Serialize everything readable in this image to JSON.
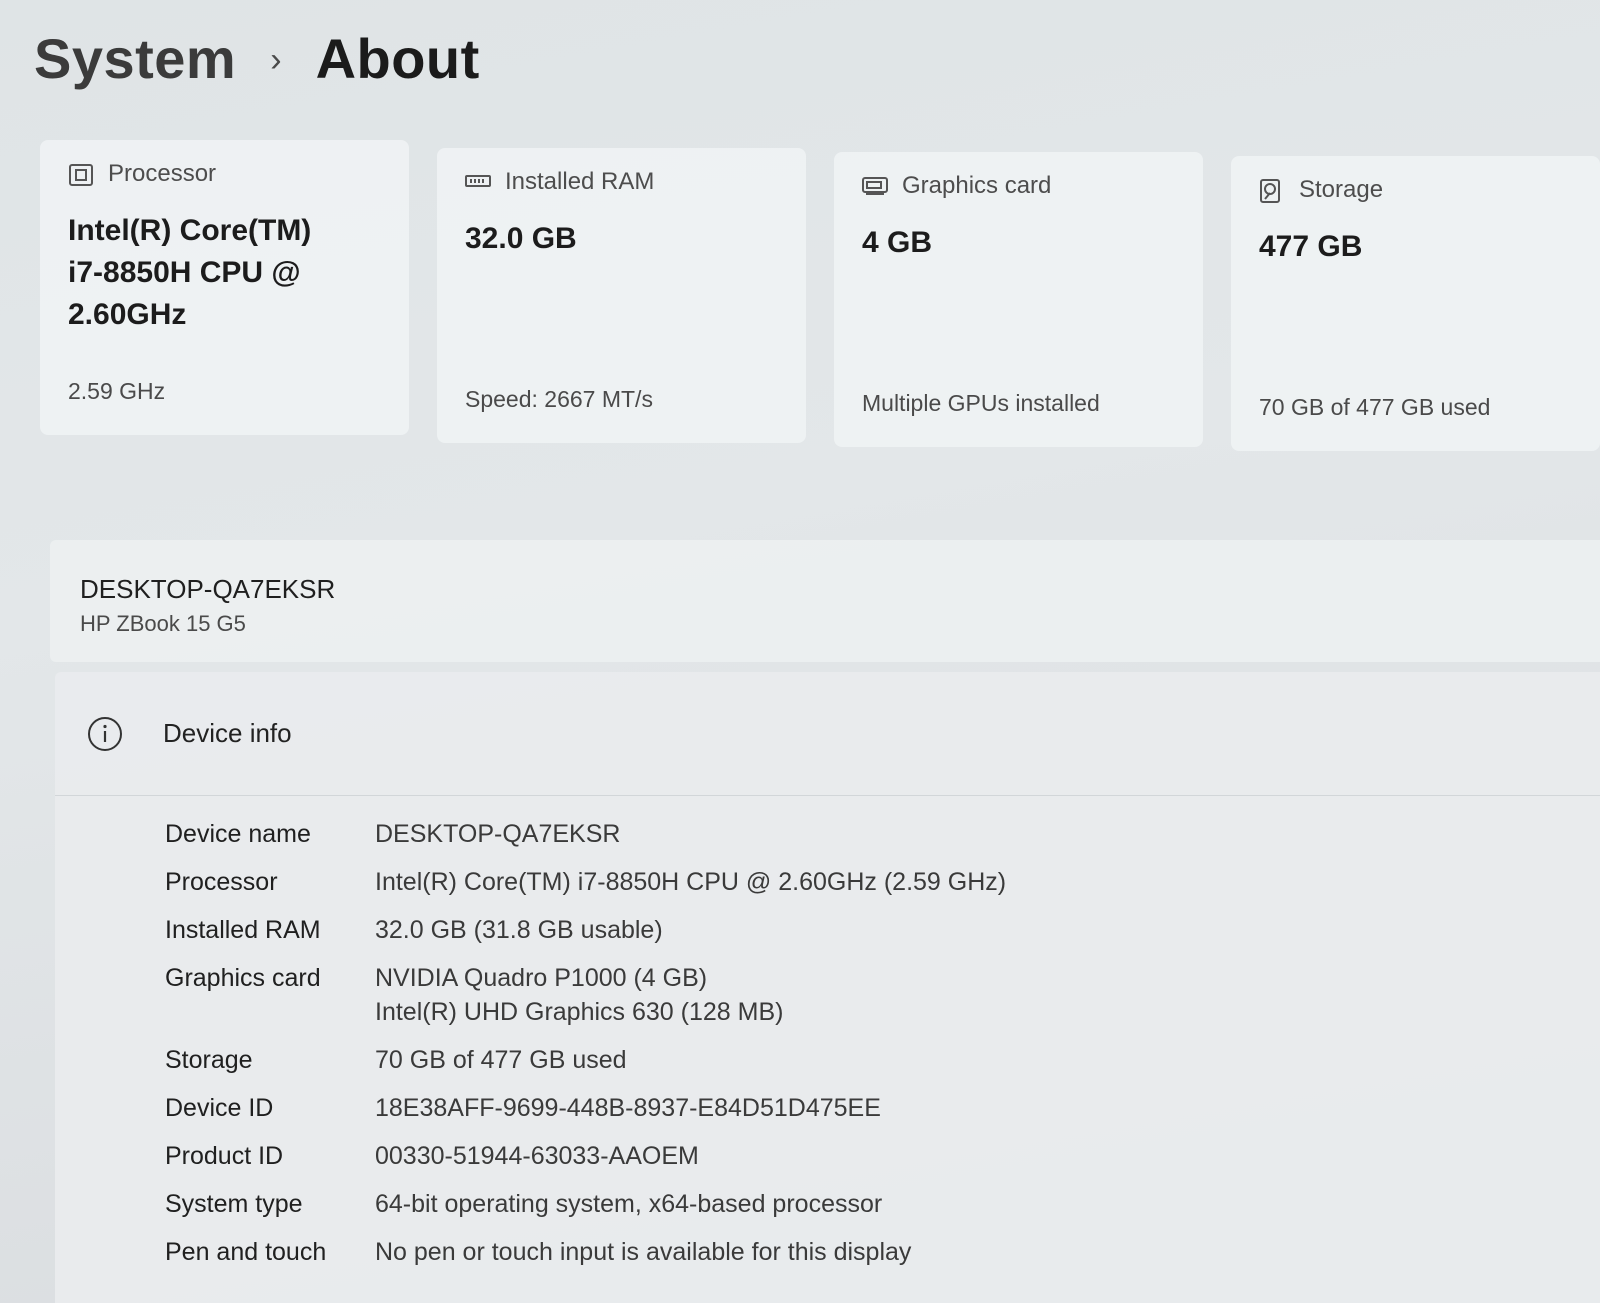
{
  "breadcrumb": {
    "parent": "System",
    "separator": "›",
    "current": "About"
  },
  "cards": [
    {
      "icon": "processor-icon",
      "label": "Processor",
      "value": "Intel(R) Core(TM) i7-8850H CPU @ 2.60GHz",
      "sub": "2.59 GHz"
    },
    {
      "icon": "ram-icon",
      "label": "Installed RAM",
      "value": "32.0 GB",
      "sub": "Speed: 2667 MT/s"
    },
    {
      "icon": "graphics-card-icon",
      "label": "Graphics card",
      "value": "4 GB",
      "sub": "Multiple GPUs installed"
    },
    {
      "icon": "storage-icon",
      "label": "Storage",
      "value": "477 GB",
      "sub": "70 GB of 477 GB used"
    }
  ],
  "device": {
    "hostname": "DESKTOP-QA7EKSR",
    "model": "HP ZBook 15 G5"
  },
  "device_info": {
    "title": "Device info",
    "specs": [
      {
        "key": "Device name",
        "value": "DESKTOP-QA7EKSR"
      },
      {
        "key": "Processor",
        "value": "Intel(R) Core(TM) i7-8850H CPU @ 2.60GHz (2.59 GHz)"
      },
      {
        "key": "Installed RAM",
        "value": "32.0 GB (31.8 GB usable)"
      },
      {
        "key": "Graphics card",
        "value": "NVIDIA Quadro P1000 (4 GB)",
        "value2": "Intel(R) UHD Graphics 630 (128 MB)"
      },
      {
        "key": "Storage",
        "value": "70 GB of 477 GB used"
      },
      {
        "key": "Device ID",
        "value": "18E38AFF-9699-448B-8937-E84D51D475EE"
      },
      {
        "key": "Product ID",
        "value": "00330-51944-63033-AAOEM"
      },
      {
        "key": "System type",
        "value": "64-bit operating system, x64-based processor"
      },
      {
        "key": "Pen and touch",
        "value": "No pen or touch input is available for this display"
      }
    ]
  }
}
